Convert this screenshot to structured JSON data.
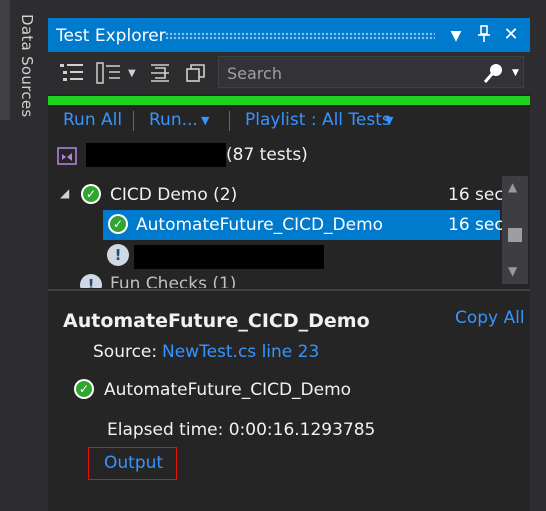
{
  "sidebar": {
    "tab_label": "Data Sources"
  },
  "window": {
    "title": "Test Explorer",
    "buttons": {
      "dropdown": "▼",
      "pin": "📌",
      "close": "✕"
    }
  },
  "toolbar": {
    "icons": [
      "group-by-icon",
      "hierarchy-icon",
      "playlist-icon",
      "collapse-icon"
    ],
    "search": {
      "placeholder": "Search",
      "value": ""
    }
  },
  "progress": {
    "percent": 100,
    "color": "#1ed31e"
  },
  "run_bar": {
    "run_all": "Run All",
    "run": "Run...",
    "playlist": "Playlist : All Tests"
  },
  "summary": {
    "count_text": "(87 tests)"
  },
  "tree": {
    "group": {
      "label": "CICD Demo (2)",
      "duration": "16 sec"
    },
    "selected_test": {
      "label": "AutomateFuture_CICD_Demo",
      "duration": "16 sec"
    },
    "partial_row_label": "Fun Checks (1)"
  },
  "details": {
    "title": "AutomateFuture_CICD_Demo",
    "copy_all": "Copy All",
    "source_label": "Source:",
    "source_link": "NewTest.cs line 23",
    "result_name": "AutomateFuture_CICD_Demo",
    "elapsed": "Elapsed time: 0:00:16.1293785",
    "output_link": "Output"
  },
  "colors": {
    "accent": "#007acc",
    "link": "#3794ff",
    "pass": "#30a530",
    "highlight_border": "#e51400"
  }
}
